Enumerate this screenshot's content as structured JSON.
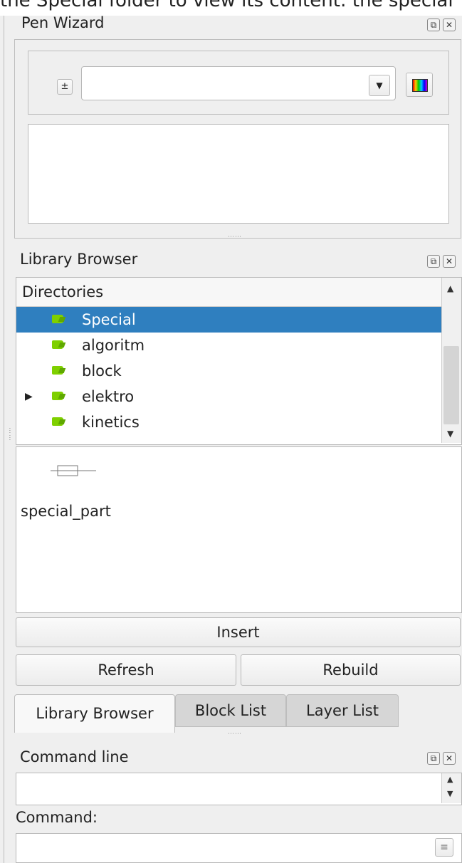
{
  "top_clip_text": "the Special folder to view its content: the special",
  "pen_wizard": {
    "title": "Pen Wizard",
    "plus_minus_symbol": "±",
    "combo_value": "",
    "dropdown_icon": "chevron-down-icon",
    "color_icon": "color-swatch-icon"
  },
  "library_browser": {
    "title": "Library Browser",
    "directories_header": "Directories",
    "items": [
      {
        "label": "Special",
        "selected": true,
        "expandable": false
      },
      {
        "label": "algoritm",
        "selected": false,
        "expandable": false
      },
      {
        "label": "block",
        "selected": false,
        "expandable": false
      },
      {
        "label": "elektro",
        "selected": false,
        "expandable": true
      },
      {
        "label": "kinetics",
        "selected": false,
        "expandable": false
      }
    ],
    "preview_item_label": "special_part",
    "buttons": {
      "insert": "Insert",
      "refresh": "Refresh",
      "rebuild": "Rebuild"
    }
  },
  "tabs": [
    {
      "label": "Library Browser",
      "active": true
    },
    {
      "label": "Block List",
      "active": false
    },
    {
      "label": "Layer List",
      "active": false
    }
  ],
  "command_line": {
    "title": "Command line",
    "command_label": "Command:",
    "input_value": ""
  },
  "dock_icons": {
    "float": "float-icon",
    "close": "close-icon"
  },
  "colors": {
    "selection": "#2f7fbf",
    "folder": "#7fd000"
  }
}
